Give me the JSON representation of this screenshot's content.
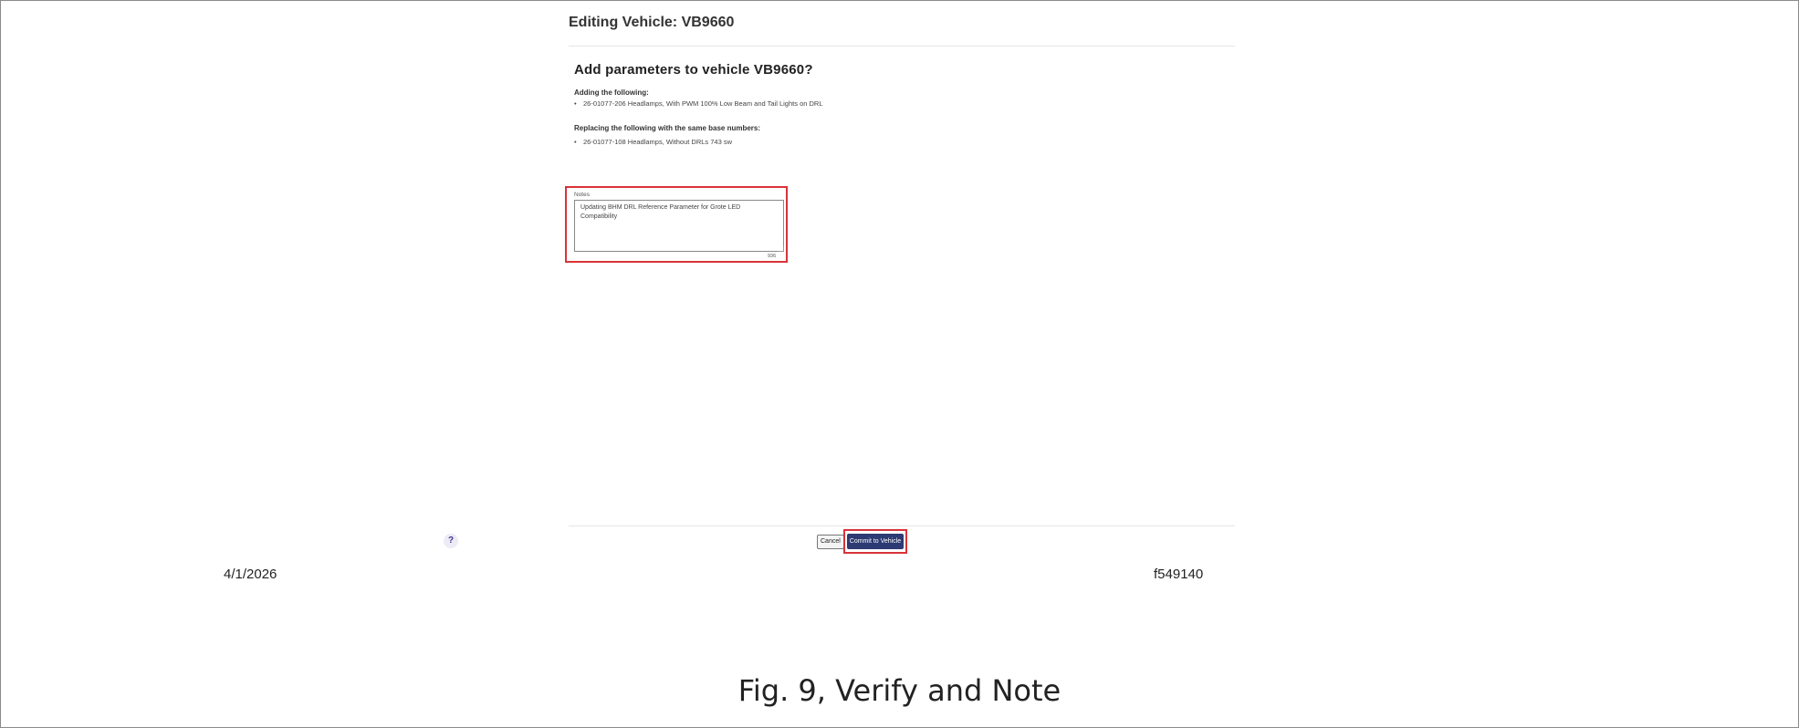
{
  "page": {
    "title": "Editing Vehicle: VB9660"
  },
  "dialog": {
    "heading": "Add parameters to vehicle VB9660?",
    "adding_label": "Adding the following:",
    "adding_items": [
      "26-01077-206 Headlamps, With PWM 100% Low Beam and Tail Lights on DRL"
    ],
    "replacing_label": "Replacing the following with the same base numbers:",
    "replacing_items": [
      "26-01077-108 Headlamps, Without DRLs 743 sw"
    ],
    "notes": {
      "label": "Notes",
      "value": "Updating BHM DRL Reference Parameter for Grote LED Compatibility",
      "counter": "936"
    }
  },
  "footer": {
    "help_icon": "question-mark-icon",
    "cancel_label": "Cancel",
    "commit_label": "Commit to Vehicle"
  },
  "document": {
    "date": "4/1/2026",
    "figure_id": "f549140",
    "caption": "Fig. 9, Verify and Note"
  },
  "colors": {
    "highlight": "#d9333a",
    "primary_button": "#2d3a73"
  }
}
